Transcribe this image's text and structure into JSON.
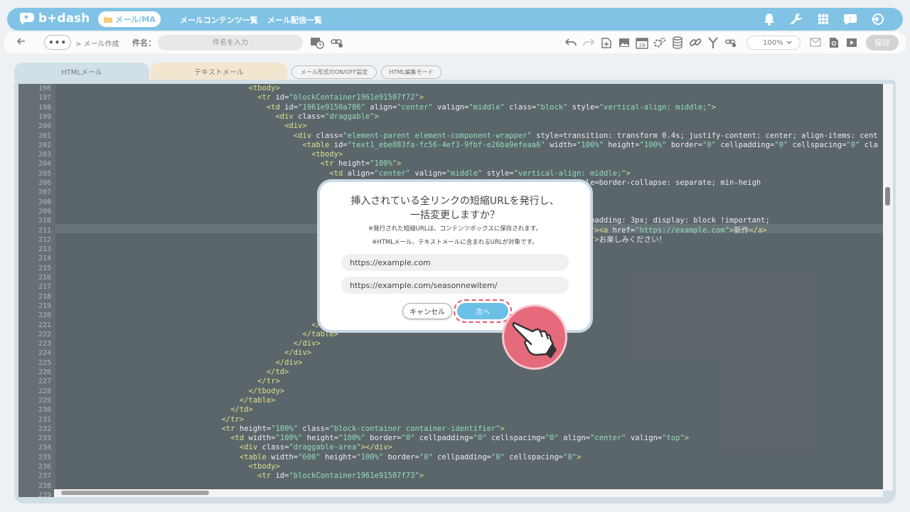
{
  "app": {
    "logo_text": "b+dash",
    "nav_active": "メール/MA",
    "nav_links": [
      "メールコンテンツ一覧",
      "メール配信一覧"
    ]
  },
  "toolbar": {
    "more_label": "•••",
    "breadcrumb": "> メール作成",
    "subject_label": "件名：",
    "subject_placeholder": "件名を入力",
    "zoom_value": "100%",
    "save_label": "保存"
  },
  "tabs": {
    "html": "HTMLメール",
    "text": "テキストメール",
    "format_toggle": "メール形式のON/OFF設定",
    "html_mode": "HTML編集モード"
  },
  "editor": {
    "line_numbers": [
      "196",
      "197",
      "198",
      "199",
      "200",
      "201",
      "202",
      "203",
      "204",
      "205",
      "206",
      "207",
      "208",
      "209",
      "210",
      "211",
      "212",
      "213",
      "214",
      "215",
      "216",
      "217",
      "218",
      "219",
      "220",
      "221",
      "222",
      "223",
      "224",
      "225",
      "226",
      "227",
      "228",
      "229",
      "230",
      "231",
      "232",
      "233",
      "234",
      "235",
      "236",
      "237",
      "238",
      "239"
    ],
    "code_lines": [
      "                                          <tbody>",
      "                                            <tr id=\"blockContainer1961e91507f72\">",
      "                                              <td id=\"1961e9150a786\" align=\"center\" valign=\"middle\" class=\"block\" style=\"vertical-align: middle;\">",
      "                                                <div class=\"draggable\">",
      "                                                  <div>",
      "                                                    <div class=\"element-parent element-component-wrapper\" style=\"transition: transform 0.4s; justify-content: center; align-items: cent",
      "                                                      <table id=\"text1_ebe083fa-fc56-4ef3-9fbf-e26ba9efeaa6\" width=\"100%\" height=\"100%\" border=\"0\" cellpadding=\"0\" cellspacing=\"0\" cla",
      "                                                        <tbody>",
      "                                                          <tr height=\"100%\">",
      "                                                            <td align=\"center\" valign=\"middle\" style=\"vertical-align: middle;\">",
      "                                                                                           padding=\"0\" border=\"0\" style=\"border-collapse: separate; min-heigh",
      "",
      "",
      "                                                                                                height: max-content;\">",
      "                                                                                              ce-content-body\" style=\"padding: 3px; display: block !important;",
      "                                                                                              le=\"font-weight: bolder;\"><a href=\"https://example.com\">新作</a>",
      "                                                                                              le=\"font-weight: bolder;\">お楽しみください！",
      "",
      "",
      "",
      "",
      "",
      "",
      "",
      "",
      "                                                        </tbody>",
      "                                                      </table>",
      "                                                    </div>",
      "                                                  </div>",
      "                                                </div>",
      "                                              </td>",
      "                                            </tr>",
      "                                          </tbody>",
      "                                        </table>",
      "                                      </td>",
      "                                    </tr>",
      "                                    <tr height=\"100%\" class=\"block-container container-identifier\">",
      "                                      <td width=\"100%\" height=\"100%\" border=\"0\" cellpadding=\"0\" cellspacing=\"0\" align=\"center\" valign=\"top\">",
      "                                        <div class=\"draggable-area\"></div>",
      "                                        <table width=\"600\" height=\"100%\" border=\"0\" cellpadding=\"0\" cellspacing=\"0\">",
      "                                          <tbody>",
      "                                            <tr id=\"blockContainer1961e91507f73\">",
      ""
    ]
  },
  "modal": {
    "title_line1": "挿入されている全リンクの短縮URLを発行し、",
    "title_line2": "一括変更しますか？",
    "note1": "※発行された短縮URLは、コンテンツボックスに保存されます。",
    "note2": "※HTMLメール、テキストメールに含まれるURLが対象です。",
    "urls": [
      "https://example.com",
      "https://example.com/seasonnewitem/"
    ],
    "cancel_label": "キャンセル",
    "next_label": "次へ"
  },
  "colors": {
    "brand": "#5eb3de",
    "editor_bg": "#2e3b41",
    "tag": "#d9d86e",
    "attr": "#e8e8e8",
    "string": "#74d4a7",
    "highlight": "#e0586c"
  },
  "icons": [
    "bell-icon",
    "wrench-icon",
    "grid-icon",
    "chat-icon",
    "logout-icon",
    "undo-icon",
    "redo-icon",
    "add-doc-icon",
    "image-icon",
    "calendar-icon",
    "settings-icon",
    "database-icon",
    "link-icon",
    "branch-icon",
    "link-settings-icon",
    "mail-icon",
    "doc-search-icon",
    "play-icon",
    "pointing-hand-icon"
  ]
}
